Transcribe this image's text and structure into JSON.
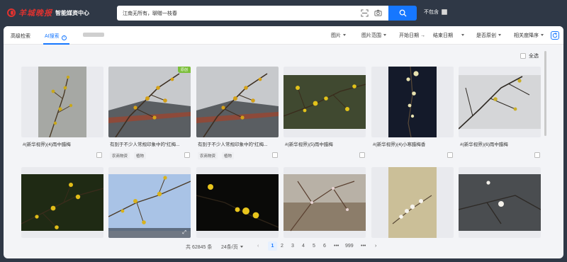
{
  "brand": {
    "name": "羊城晚报",
    "subtitle": "智能媒资中心"
  },
  "search": {
    "value": "江南无所有，聊赠一枝春",
    "exclude_label": "不包含"
  },
  "tabs": [
    {
      "label": "高级检索",
      "active": false
    },
    {
      "label": "AI搜索",
      "active": true
    }
  ],
  "filters": [
    {
      "label": "图片"
    },
    {
      "label": "图片范围"
    },
    {
      "label": "开始日期"
    },
    {
      "label": "结束日期"
    },
    {
      "label": "是否原创"
    },
    {
      "label": "相关度降序"
    }
  ],
  "select_all": "全选",
  "row1": [
    {
      "caption": "#(新华视界)(4)雨中腊梅",
      "tags": []
    },
    {
      "caption": "有别于不少人常规印象中的“红梅...",
      "tags": [
        "农商物资",
        "植物"
      ],
      "badge": "原创"
    },
    {
      "caption": "有别于不少人常规印象中的“红梅...",
      "tags": [
        "农商物资",
        "植物"
      ]
    },
    {
      "caption": "#(新华视界)(5)雨中腊梅",
      "tags": []
    },
    {
      "caption": "#(新华视界)(4)小寒腊梅香",
      "tags": []
    },
    {
      "caption": "#(新华视界)(6)雨中腊梅",
      "tags": []
    }
  ],
  "pagination": {
    "total": "共 62845 条",
    "page_size": "24条/页",
    "prev": "‹",
    "pages": [
      "1",
      "2",
      "3",
      "4",
      "5",
      "6"
    ],
    "ellipsis": "•••",
    "last": "999",
    "next": "›",
    "current": "1"
  },
  "icons": {
    "scan": "scan-icon",
    "camera": "camera-icon",
    "search": "search-icon",
    "refresh": "refresh-icon",
    "fullscreen": "fullscreen-icon"
  },
  "colors": {
    "accent": "#1677ff",
    "brand_red": "#e0322f",
    "header_bg": "#2f3846",
    "badge_green": "#7cbf3b"
  }
}
